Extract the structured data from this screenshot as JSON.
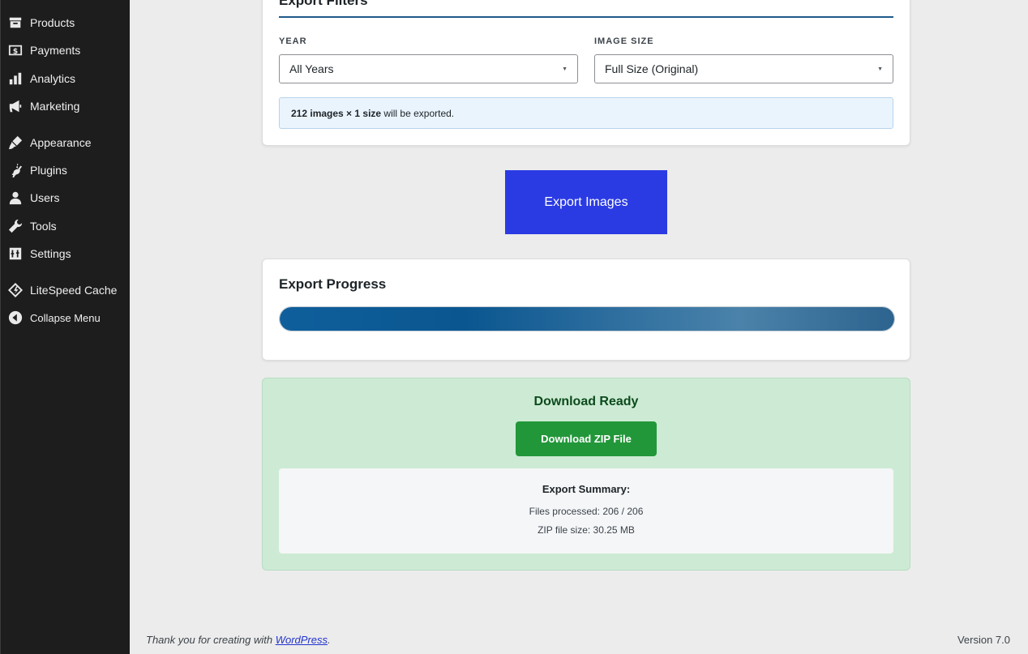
{
  "sidebar": {
    "items": [
      {
        "label": "Products",
        "icon": "archive-icon"
      },
      {
        "label": "Payments",
        "icon": "dollar-icon"
      },
      {
        "label": "Analytics",
        "icon": "bar-chart-icon"
      },
      {
        "label": "Marketing",
        "icon": "megaphone-icon"
      },
      {
        "label": "Appearance",
        "icon": "paintbrush-icon"
      },
      {
        "label": "Plugins",
        "icon": "plug-icon"
      },
      {
        "label": "Users",
        "icon": "user-icon"
      },
      {
        "label": "Tools",
        "icon": "wrench-icon"
      },
      {
        "label": "Settings",
        "icon": "sliders-icon"
      },
      {
        "label": "LiteSpeed Cache",
        "icon": "diamond-icon"
      },
      {
        "label": "Collapse Menu",
        "icon": "collapse-arrow-icon"
      }
    ]
  },
  "filters": {
    "title": "Export Filters",
    "year_label": "YEAR",
    "year_value": "All Years",
    "size_label": "IMAGE SIZE",
    "size_value": "Full Size (Original)",
    "notice_count": "212 images × 1 size",
    "notice_rest": " will be exported."
  },
  "export_button": "Export Images",
  "progress": {
    "title": "Export Progress",
    "percent": 100
  },
  "download": {
    "title": "Download Ready",
    "button": "Download ZIP File",
    "summary_title": "Export Summary:",
    "files_processed": "Files processed: 206 / 206",
    "zip_size": "ZIP file size: 30.25 MB"
  },
  "footer": {
    "thanks_prefix": "Thank you for creating with ",
    "link": "WordPress",
    "thanks_suffix": ".",
    "version": "Version 7.0"
  },
  "colors": {
    "sidebar_bg": "#1d1d1d",
    "primary_button": "#2b3be4",
    "download_button": "#22973a",
    "success_bg": "#cdebd4",
    "progress_fill": "#0a5690"
  }
}
